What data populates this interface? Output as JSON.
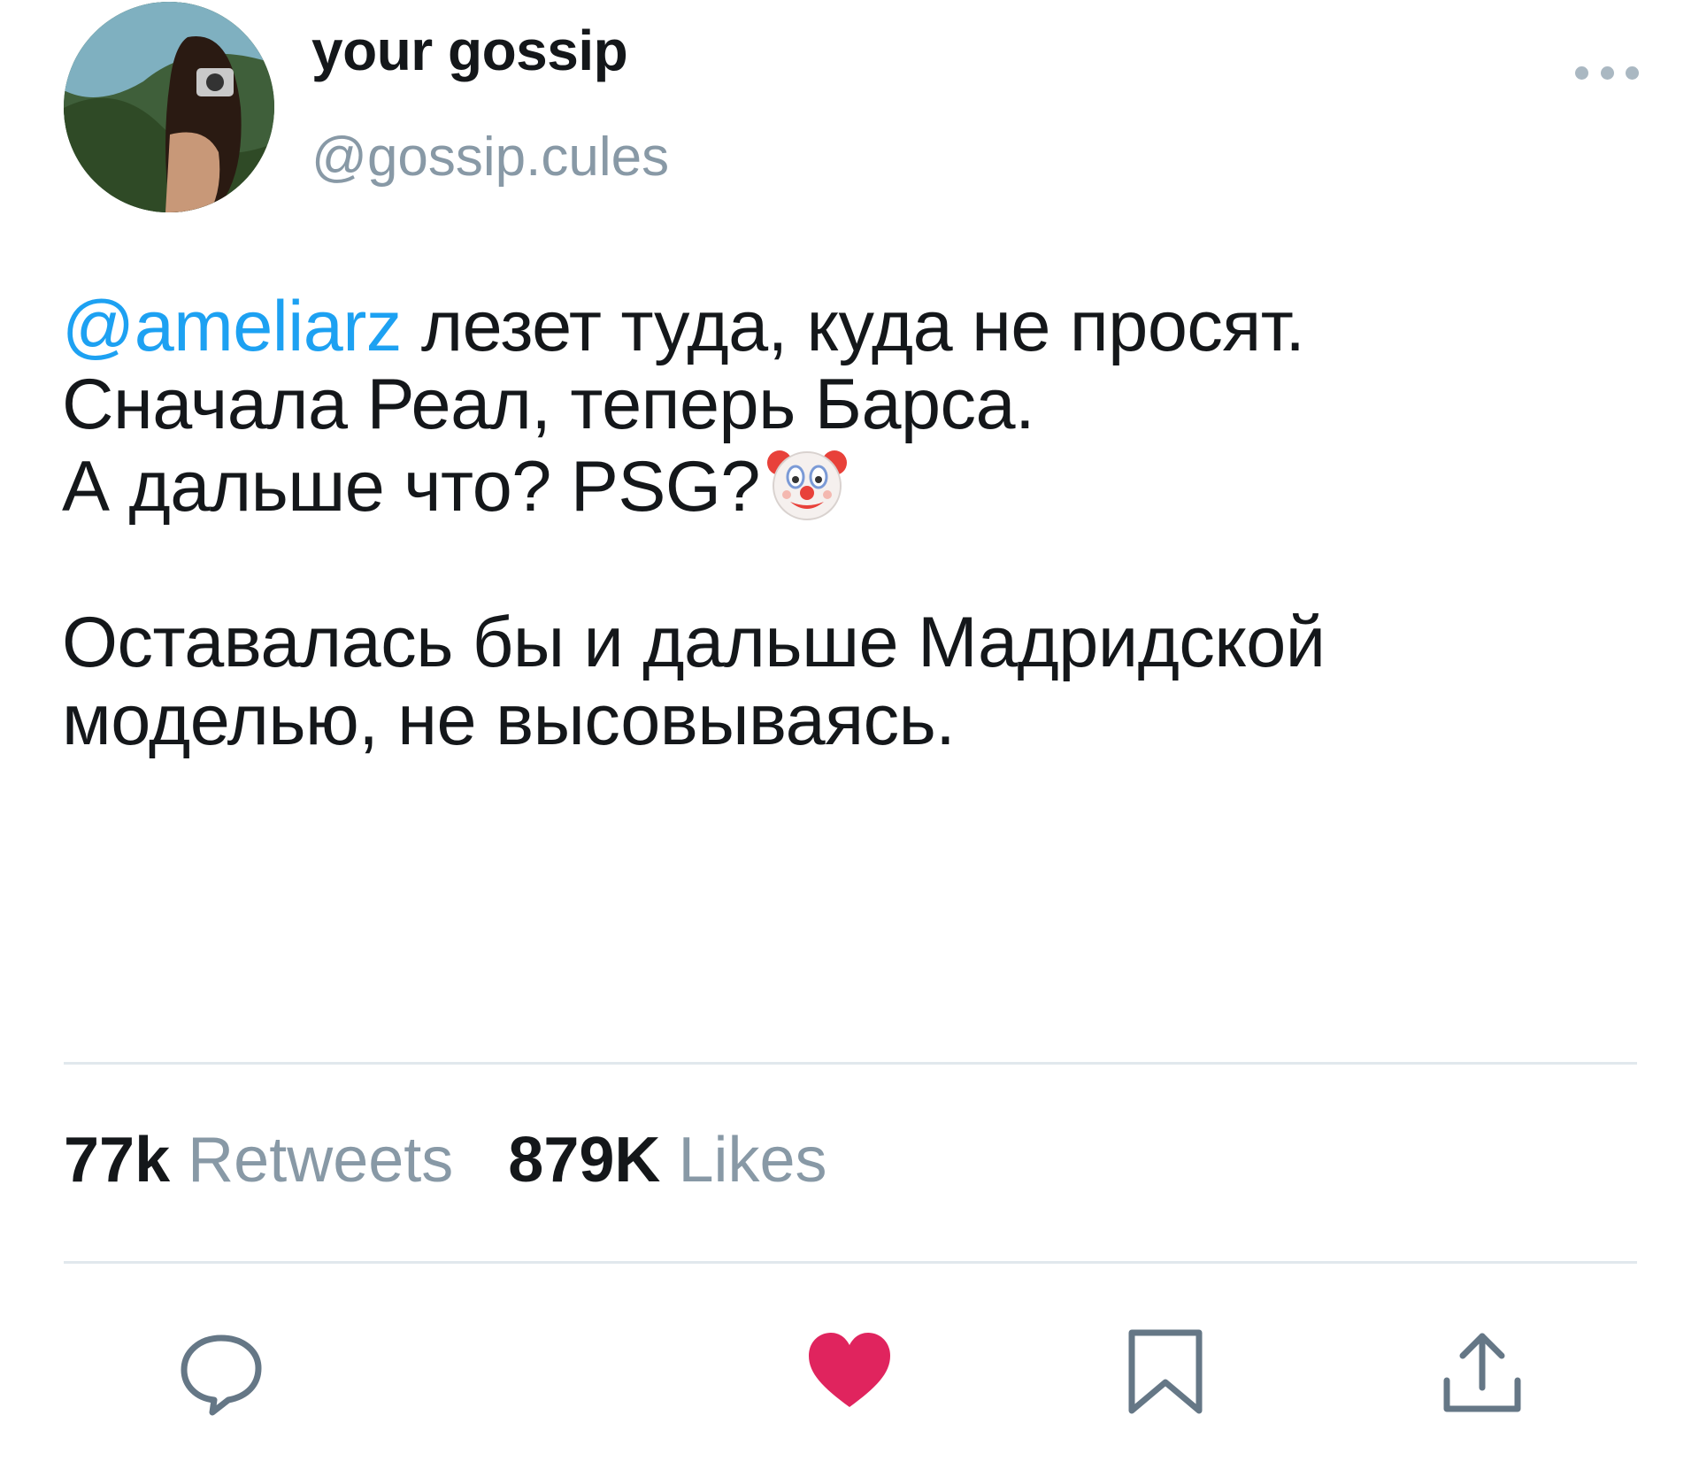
{
  "author": {
    "display_name": "your gossip",
    "handle": "@gossip.cules",
    "avatar_icon": "profile-photo"
  },
  "tweet": {
    "mention": "@ameliarz",
    "line1_rest": " лезет туда, куда не просят.",
    "line2": "Сначала Реал, теперь Барса.",
    "line3": "А дальше что? PSG?",
    "emoji_icon": "clown-face-emoji",
    "line4": "Оставалась бы и дальше Мадридской",
    "line5": "моделью, не высовываясь."
  },
  "stats": {
    "retweets_count": "77k",
    "retweets_label": "Retweets",
    "likes_count": "879K",
    "likes_label": "Likes"
  },
  "actions": {
    "reply_icon": "reply-bubble-icon",
    "like_icon": "heart-icon",
    "bookmark_icon": "bookmark-icon",
    "share_icon": "share-icon"
  },
  "colors": {
    "mention": "#1da1f2",
    "secondary_text": "#8899a6",
    "like_active": "#e0245e",
    "divider": "#e1e8ed"
  }
}
